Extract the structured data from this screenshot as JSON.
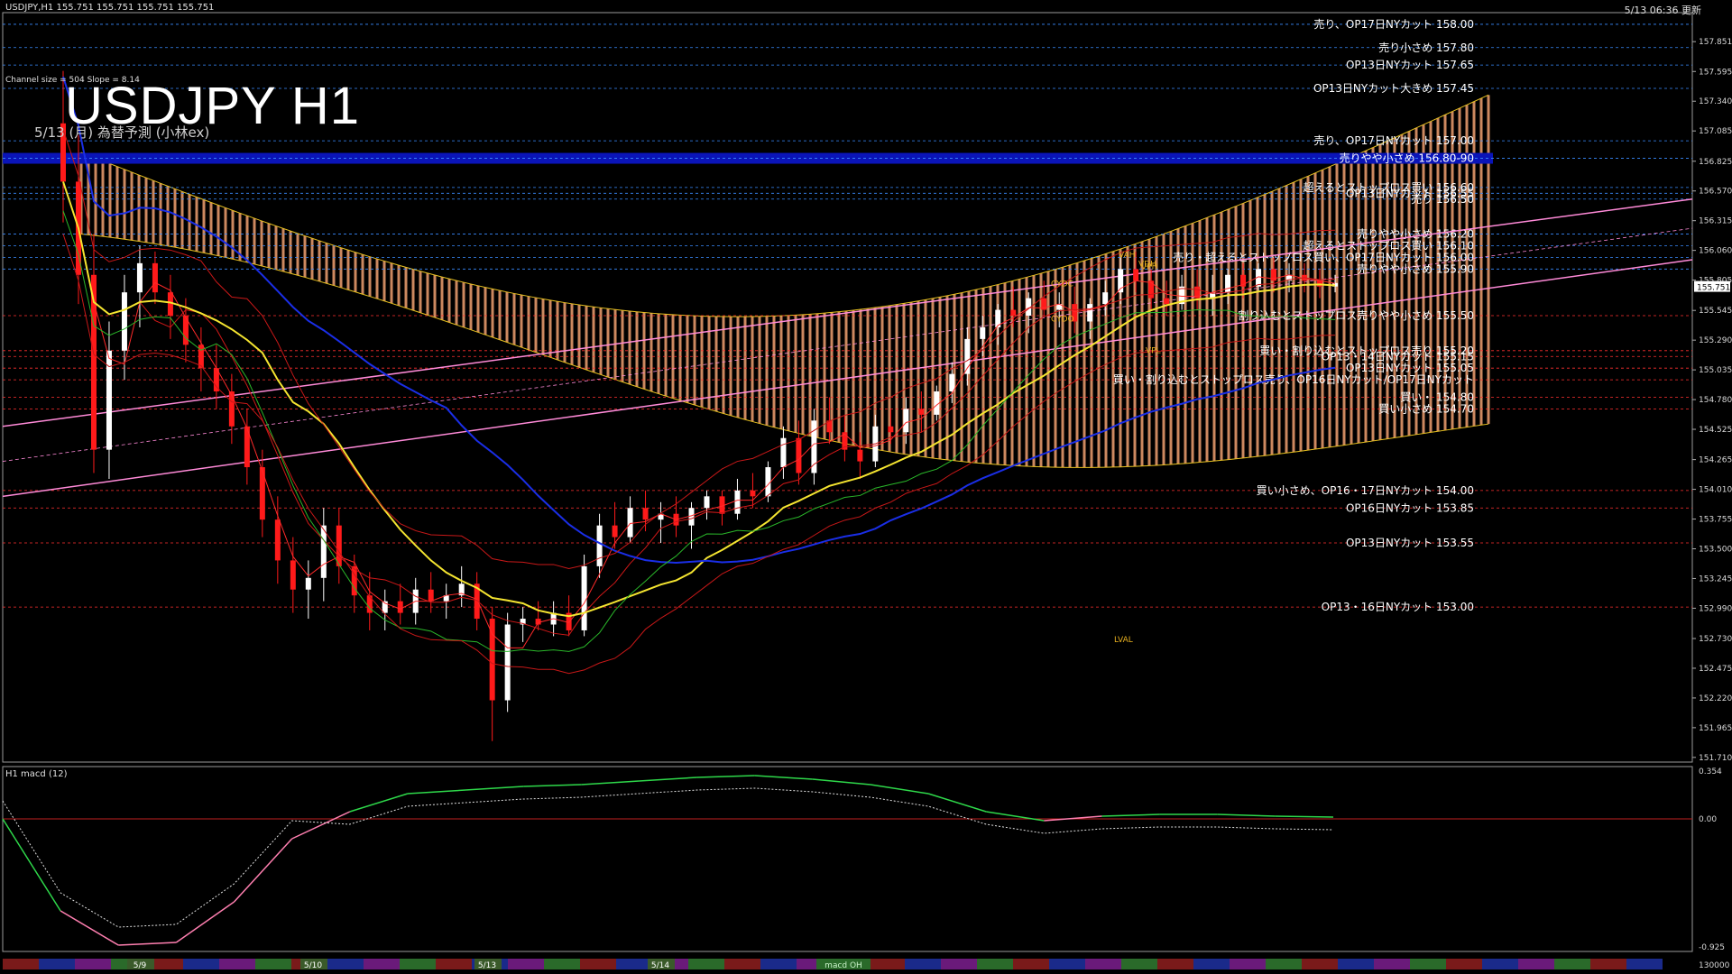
{
  "header": {
    "symbol_info": "USDJPY,H1  155.751 155.751 155.751 155.751",
    "updated": "5/13 06:36 更新",
    "title": "USDJPY H1",
    "subtitle": "5/13 (月) 為替予測 (小林ex)",
    "indicator": "Channel size = 504 Slope = 8.14",
    "macd_label": "H1  macd (12)",
    "current_price": "155.751",
    "bottom_right": "130000",
    "bottom_indicator": "macd OH"
  },
  "colors": {
    "background": "#000000",
    "candle_up": "#ffffff",
    "candle_down": "#ff1a1a",
    "ma_yellow": "#f5e530",
    "ma_blue": "#1a2ee6",
    "channel_pink": "#ff8ad8",
    "cloud_orange": "#f0a070",
    "cloud_red": "#c0302a",
    "macd_green": "#2ed84a",
    "macd_pink": "#ff7fb0"
  },
  "chart_data": {
    "type": "line",
    "price_axis": {
      "ticks": [
        "157.851",
        "157.595",
        "157.340",
        "157.085",
        "156.825",
        "156.570",
        "156.315",
        "156.060",
        "155.805",
        "155.545",
        "155.290",
        "155.035",
        "154.780",
        "154.525",
        "154.265",
        "154.010",
        "153.755",
        "153.500",
        "153.245",
        "152.990",
        "152.730",
        "152.475",
        "152.220",
        "151.965",
        "151.710"
      ],
      "ylim": [
        151.67,
        158.1
      ]
    },
    "macd_axis": {
      "ticks": [
        "0.354",
        "0.00",
        "-0.925"
      ]
    },
    "date_labels": [
      "5/9",
      "5/10",
      "5/13",
      "5/14"
    ],
    "levels": [
      {
        "label": "売り、OP17日NYカット 158.00",
        "value": 158.0,
        "color": "#3a8cff"
      },
      {
        "label": "売り小さめ 157.80",
        "value": 157.8,
        "color": "#3a8cff"
      },
      {
        "label": "OP13日NYカット 157.65",
        "value": 157.65,
        "color": "#3a8cff"
      },
      {
        "label": "OP13日NYカット大きめ 157.45",
        "value": 157.45,
        "color": "#3a8cff"
      },
      {
        "label": "売り、OP17日NYカット 157.00",
        "value": 157.0,
        "color": "#3a8cff"
      },
      {
        "label": "売りやや小さめ 156.80-90",
        "value": 156.85,
        "color": "#3a8cff",
        "band": true
      },
      {
        "label": "超えるとストップロス買い 156.60",
        "value": 156.6,
        "color": "#3a8cff"
      },
      {
        "label": "OP13日NYカット 156.55",
        "value": 156.55,
        "color": "#3a8cff"
      },
      {
        "label": "売り 156.50",
        "value": 156.5,
        "color": "#3a8cff"
      },
      {
        "label": "売りやや小さめ 156.20",
        "value": 156.2,
        "color": "#3a8cff"
      },
      {
        "label": "超えるとストップロス買い 156.10",
        "value": 156.1,
        "color": "#3a8cff"
      },
      {
        "label": "売り・超えるとストップロス買い、OP17日NYカット 156.00",
        "value": 156.0,
        "color": "#3a8cff"
      },
      {
        "label": "売りやや小さめ 155.90",
        "value": 155.9,
        "color": "#3a8cff"
      },
      {
        "label": "割り込むとストップロス売りやや小さめ 155.50",
        "value": 155.5,
        "color": "#ff3030"
      },
      {
        "label": "買い・割り込むとストップロス売り 155.20",
        "value": 155.2,
        "color": "#ff3030"
      },
      {
        "label": "OP13・14日NYカット 155.15",
        "value": 155.15,
        "color": "#ff3030"
      },
      {
        "label": "OP13日NYカット 155.05",
        "value": 155.05,
        "color": "#ff3030"
      },
      {
        "label": "買い・割り込むとストップロス売り、OP16日NYカット/OP17日NYカット",
        "value": 154.95,
        "color": "#ff3030"
      },
      {
        "label": "買い・ 154.80",
        "value": 154.8,
        "color": "#ff3030"
      },
      {
        "label": "買い小さめ 154.70",
        "value": 154.7,
        "color": "#ff3030"
      },
      {
        "label": "買い小さめ、OP16・17日NYカット 154.00",
        "value": 154.0,
        "color": "#ff3030"
      },
      {
        "label": "OP16日NYカット 153.85",
        "value": 153.85,
        "color": "#ff3030"
      },
      {
        "label": "OP13日NYカット 153.55",
        "value": 153.55,
        "color": "#ff3030"
      },
      {
        "label": "OP13・16日NYカット 153.00",
        "value": 153.0,
        "color": "#ff3030"
      }
    ],
    "marker_labels": [
      "VAH",
      "VPH",
      "VDH",
      "CYDC",
      "CYDO",
      "LVAL",
      "VPL"
    ],
    "candles": [
      [
        157.15,
        157.6,
        156.3,
        156.65
      ],
      [
        156.65,
        157.05,
        155.6,
        155.85
      ],
      [
        155.85,
        156.2,
        154.15,
        154.35
      ],
      [
        154.35,
        155.45,
        154.1,
        155.2
      ],
      [
        155.2,
        155.85,
        154.95,
        155.7
      ],
      [
        155.7,
        156.1,
        155.4,
        155.95
      ],
      [
        155.95,
        156.05,
        155.6,
        155.7
      ],
      [
        155.7,
        155.85,
        155.3,
        155.5
      ],
      [
        155.5,
        155.65,
        155.1,
        155.25
      ],
      [
        155.25,
        155.4,
        154.85,
        155.05
      ],
      [
        155.05,
        155.25,
        154.7,
        154.85
      ],
      [
        154.85,
        155.0,
        154.4,
        154.55
      ],
      [
        154.55,
        154.7,
        154.05,
        154.2
      ],
      [
        154.2,
        154.35,
        153.6,
        153.75
      ],
      [
        153.75,
        153.95,
        153.2,
        153.4
      ],
      [
        153.4,
        153.6,
        152.95,
        153.15
      ],
      [
        153.15,
        153.4,
        152.9,
        153.25
      ],
      [
        153.25,
        153.85,
        153.05,
        153.7
      ],
      [
        153.7,
        153.85,
        153.2,
        153.35
      ],
      [
        153.35,
        153.45,
        152.95,
        153.1
      ],
      [
        153.1,
        153.3,
        152.8,
        152.95
      ],
      [
        152.95,
        153.15,
        152.8,
        153.05
      ],
      [
        153.05,
        153.2,
        152.85,
        152.95
      ],
      [
        152.95,
        153.25,
        152.85,
        153.15
      ],
      [
        153.15,
        153.3,
        152.95,
        153.05
      ],
      [
        153.05,
        153.2,
        152.9,
        153.1
      ],
      [
        153.1,
        153.35,
        153.0,
        153.2
      ],
      [
        153.2,
        153.3,
        152.8,
        152.9
      ],
      [
        152.9,
        153.0,
        151.85,
        152.2
      ],
      [
        152.2,
        152.95,
        152.1,
        152.85
      ],
      [
        152.85,
        153.0,
        152.7,
        152.9
      ],
      [
        152.9,
        153.05,
        152.8,
        152.85
      ],
      [
        152.85,
        153.05,
        152.75,
        152.95
      ],
      [
        152.95,
        153.1,
        152.75,
        152.8
      ],
      [
        152.8,
        153.45,
        152.75,
        153.35
      ],
      [
        153.35,
        153.8,
        153.25,
        153.7
      ],
      [
        153.7,
        153.9,
        153.5,
        153.6
      ],
      [
        153.6,
        153.95,
        153.55,
        153.85
      ],
      [
        153.85,
        154.0,
        153.65,
        153.75
      ],
      [
        153.75,
        153.9,
        153.55,
        153.8
      ],
      [
        153.8,
        153.95,
        153.6,
        153.7
      ],
      [
        153.7,
        153.9,
        153.5,
        153.85
      ],
      [
        153.85,
        154.0,
        153.75,
        153.95
      ],
      [
        153.95,
        154.0,
        153.7,
        153.8
      ],
      [
        153.8,
        154.1,
        153.75,
        154.0
      ],
      [
        154.0,
        154.15,
        153.85,
        153.95
      ],
      [
        153.95,
        154.25,
        153.9,
        154.2
      ],
      [
        154.2,
        154.55,
        154.1,
        154.45
      ],
      [
        154.45,
        154.6,
        154.05,
        154.15
      ],
      [
        154.15,
        154.7,
        154.05,
        154.6
      ],
      [
        154.6,
        154.8,
        154.4,
        154.5
      ],
      [
        154.5,
        154.65,
        154.25,
        154.35
      ],
      [
        154.35,
        154.5,
        154.1,
        154.25
      ],
      [
        154.25,
        154.65,
        154.2,
        154.55
      ],
      [
        154.55,
        154.7,
        154.4,
        154.5
      ],
      [
        154.5,
        154.8,
        154.4,
        154.7
      ],
      [
        154.7,
        154.85,
        154.5,
        154.65
      ],
      [
        154.65,
        154.9,
        154.6,
        154.85
      ],
      [
        154.85,
        155.1,
        154.75,
        155.0
      ],
      [
        155.0,
        155.4,
        154.9,
        155.3
      ],
      [
        155.3,
        155.5,
        155.15,
        155.4
      ],
      [
        155.4,
        155.6,
        155.25,
        155.55
      ],
      [
        155.55,
        155.75,
        155.4,
        155.5
      ],
      [
        155.5,
        155.7,
        155.35,
        155.65
      ],
      [
        155.65,
        155.8,
        155.5,
        155.55
      ],
      [
        155.55,
        155.7,
        155.4,
        155.6
      ],
      [
        155.6,
        155.75,
        155.35,
        155.45
      ],
      [
        155.45,
        155.65,
        155.3,
        155.6
      ],
      [
        155.6,
        155.8,
        155.5,
        155.7
      ],
      [
        155.7,
        156.0,
        155.6,
        155.9
      ],
      [
        155.9,
        156.05,
        155.7,
        155.8
      ],
      [
        155.8,
        155.9,
        155.55,
        155.65
      ],
      [
        155.65,
        155.8,
        155.5,
        155.6
      ],
      [
        155.6,
        155.85,
        155.55,
        155.75
      ],
      [
        155.75,
        155.9,
        155.55,
        155.65
      ],
      [
        155.65,
        155.85,
        155.5,
        155.7
      ],
      [
        155.7,
        155.9,
        155.6,
        155.85
      ],
      [
        155.85,
        155.95,
        155.65,
        155.75
      ],
      [
        155.75,
        155.95,
        155.7,
        155.9
      ],
      [
        155.9,
        156.0,
        155.7,
        155.8
      ],
      [
        155.8,
        155.95,
        155.7,
        155.85
      ],
      [
        155.85,
        155.95,
        155.7,
        155.8
      ],
      [
        155.8,
        155.9,
        155.65,
        155.75
      ],
      [
        155.75,
        155.85,
        155.7,
        155.78
      ]
    ]
  }
}
